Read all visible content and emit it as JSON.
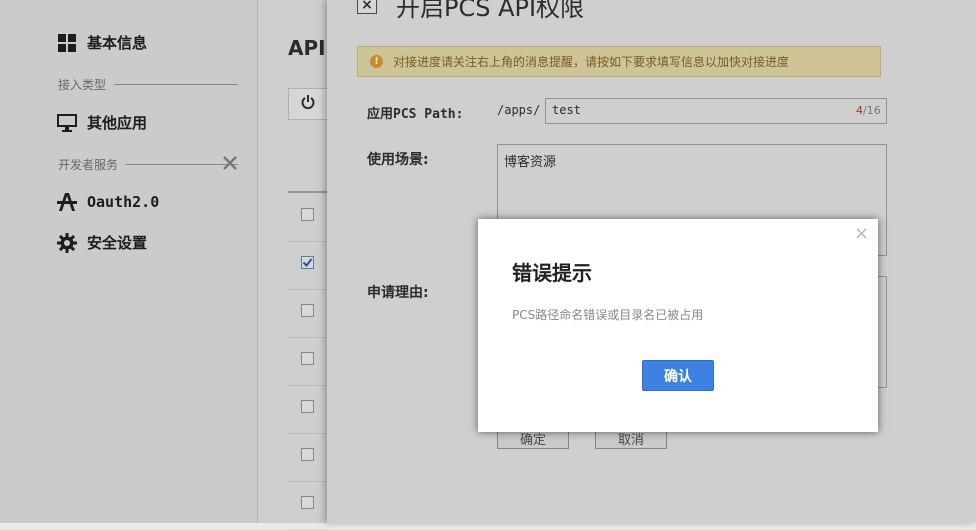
{
  "sidebar": {
    "items": [
      {
        "label": "基本信息",
        "icon": "grid-icon"
      },
      {
        "label": "其他应用",
        "icon": "monitor-icon"
      },
      {
        "label": "Oauth2.0",
        "icon": "oauth-icon"
      },
      {
        "label": "安全设置",
        "icon": "gear-icon"
      }
    ],
    "sections": {
      "access_type": "接入类型",
      "developer_service": "开发者服务"
    }
  },
  "main": {
    "title": "API",
    "power_icon": "power-icon",
    "rows": [
      {
        "checked": false
      },
      {
        "checked": true
      },
      {
        "checked": false
      },
      {
        "checked": false
      },
      {
        "checked": false
      },
      {
        "checked": false
      },
      {
        "checked": false
      }
    ]
  },
  "panel": {
    "title": "开启PCS API权限",
    "close_label": "×",
    "notice": "对接进度请关注右上角的消息提醒，请按如下要求填写信息以加快对接进度",
    "path_label": "应用PCS Path:",
    "path_prefix": "/apps/",
    "path_value": "test",
    "path_count": "4",
    "path_max": "/16",
    "scene_label": "使用场景:",
    "scene_value": "博客资源",
    "reason_label": "申请理由:",
    "confirm_label": "确定",
    "cancel_label": "取消"
  },
  "modal": {
    "title": "错误提示",
    "message": "PCS路径命名错误或目录名已被占用",
    "ok_label": "确认",
    "close_label": "×"
  },
  "colors": {
    "primary_button": "#3d82e0",
    "notice_bg": "#ecdfae",
    "counter_current": "#c0392b"
  }
}
